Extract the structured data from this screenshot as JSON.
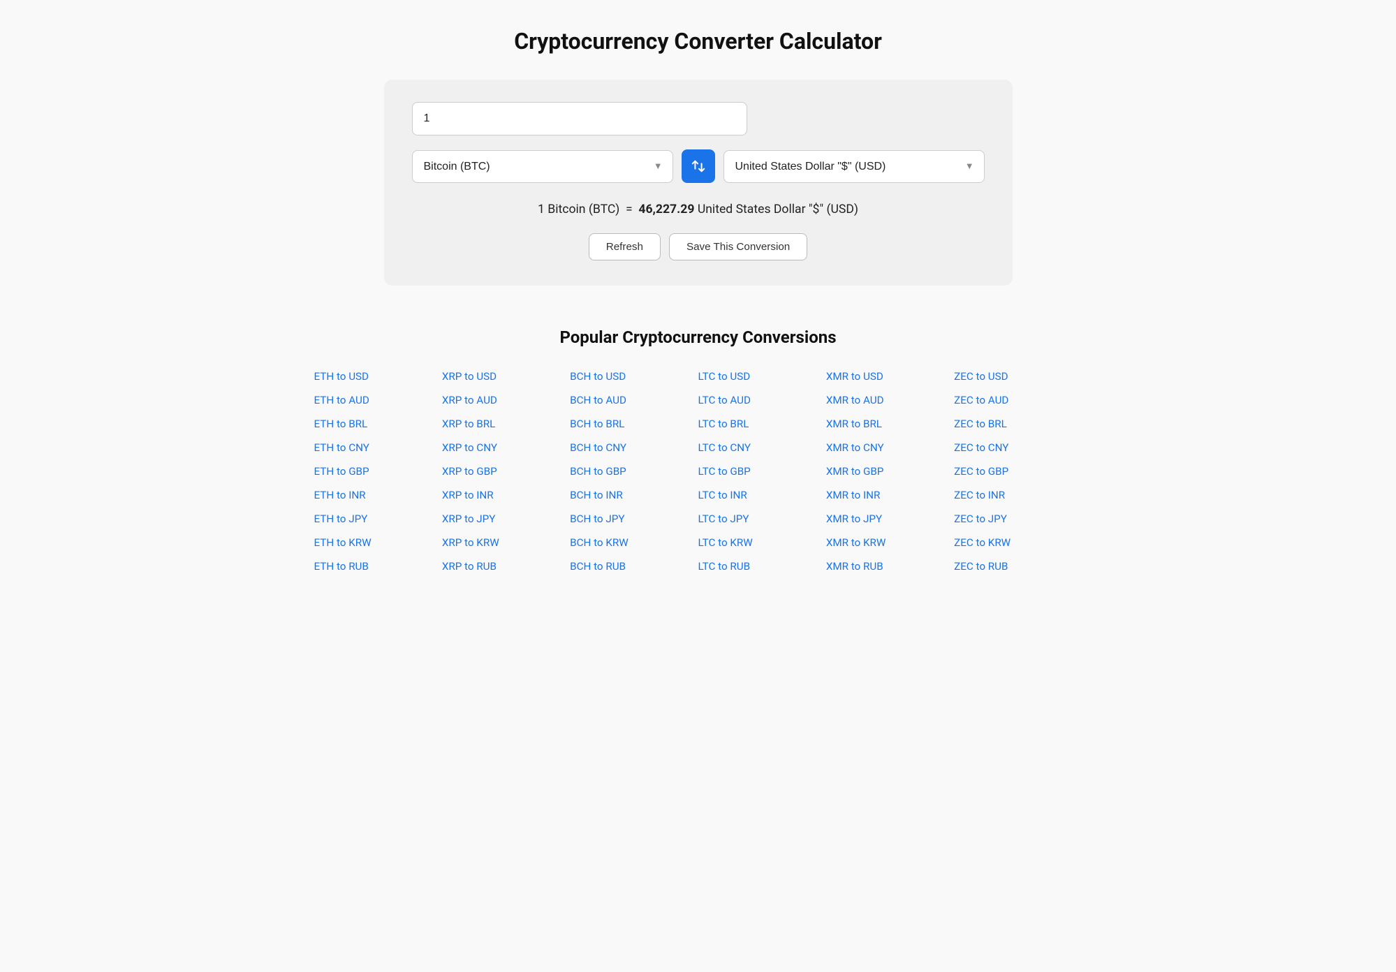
{
  "page": {
    "title": "Cryptocurrency Converter Calculator"
  },
  "converter": {
    "amount_value": "1",
    "from_currency_label": "Bitcoin (BTC)",
    "to_currency_label": "United States Dollar \"$\" (USD)",
    "result_text_prefix": "1 Bitcoin (BTC)",
    "result_equals": "=",
    "result_value": "46,227.29",
    "result_text_suffix": "United States Dollar \"$\" (USD)",
    "refresh_label": "Refresh",
    "save_label": "Save This Conversion",
    "swap_label": "Swap currencies"
  },
  "popular": {
    "title": "Popular Cryptocurrency Conversions",
    "columns": [
      {
        "links": [
          "ETH to USD",
          "ETH to AUD",
          "ETH to BRL",
          "ETH to CNY",
          "ETH to GBP",
          "ETH to INR",
          "ETH to JPY",
          "ETH to KRW",
          "ETH to RUB"
        ]
      },
      {
        "links": [
          "XRP to USD",
          "XRP to AUD",
          "XRP to BRL",
          "XRP to CNY",
          "XRP to GBP",
          "XRP to INR",
          "XRP to JPY",
          "XRP to KRW",
          "XRP to RUB"
        ]
      },
      {
        "links": [
          "BCH to USD",
          "BCH to AUD",
          "BCH to BRL",
          "BCH to CNY",
          "BCH to GBP",
          "BCH to INR",
          "BCH to JPY",
          "BCH to KRW",
          "BCH to RUB"
        ]
      },
      {
        "links": [
          "LTC to USD",
          "LTC to AUD",
          "LTC to BRL",
          "LTC to CNY",
          "LTC to GBP",
          "LTC to INR",
          "LTC to JPY",
          "LTC to KRW",
          "LTC to RUB"
        ]
      },
      {
        "links": [
          "XMR to USD",
          "XMR to AUD",
          "XMR to BRL",
          "XMR to CNY",
          "XMR to GBP",
          "XMR to INR",
          "XMR to JPY",
          "XMR to KRW",
          "XMR to RUB"
        ]
      },
      {
        "links": [
          "ZEC to USD",
          "ZEC to AUD",
          "ZEC to BRL",
          "ZEC to CNY",
          "ZEC to GBP",
          "ZEC to INR",
          "ZEC to JPY",
          "ZEC to KRW",
          "ZEC to RUB"
        ]
      }
    ]
  }
}
